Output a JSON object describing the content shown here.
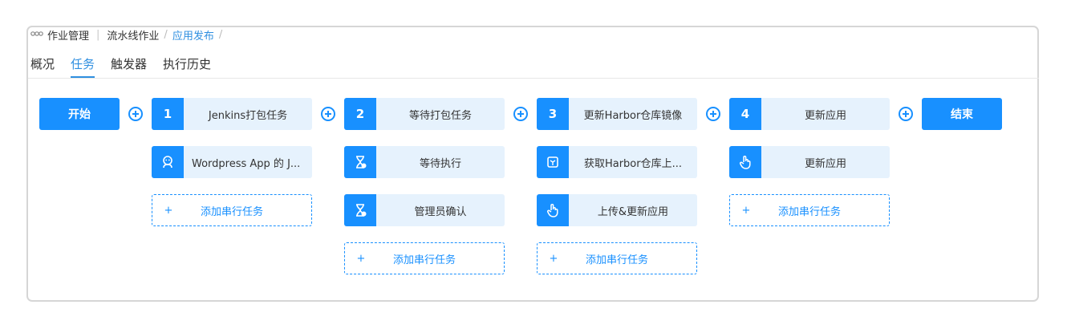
{
  "breadcrumb": {
    "icon": "app-grid-icon",
    "root": "作业管理",
    "separator_bar": "|",
    "pipeline": "流水线作业",
    "sep": "/",
    "current": "应用发布",
    "trailing_sep": "/"
  },
  "tabs": [
    {
      "label": "概况",
      "active": false
    },
    {
      "label": "任务",
      "active": true
    },
    {
      "label": "触发器",
      "active": false
    },
    {
      "label": "执行历史",
      "active": false
    }
  ],
  "pipeline": {
    "start_label": "开始",
    "end_label": "结束",
    "add_serial_label": "添加串行任务",
    "add_plus": "+",
    "stages": [
      {
        "number": "1",
        "title": "Jenkins打包任务",
        "tasks": [
          {
            "icon": "jenkins-icon",
            "label": "Wordpress App 的 J..."
          }
        ]
      },
      {
        "number": "2",
        "title": "等待打包任务",
        "tasks": [
          {
            "icon": "hourglass-icon",
            "label": "等待执行"
          },
          {
            "icon": "hourglass-icon",
            "label": "管理员确认"
          }
        ]
      },
      {
        "number": "3",
        "title": "更新Harbor仓库镜像",
        "tasks": [
          {
            "icon": "box-icon",
            "label": "获取Harbor仓库上..."
          },
          {
            "icon": "pointer-hand-icon",
            "label": "上传&更新应用"
          }
        ]
      },
      {
        "number": "4",
        "title": "更新应用",
        "tasks": [
          {
            "icon": "pointer-hand-icon",
            "label": "更新应用"
          }
        ]
      }
    ]
  },
  "colors": {
    "primary": "#1890ff",
    "card_bg": "#e6f2fd",
    "link": "#2f8fe0"
  }
}
